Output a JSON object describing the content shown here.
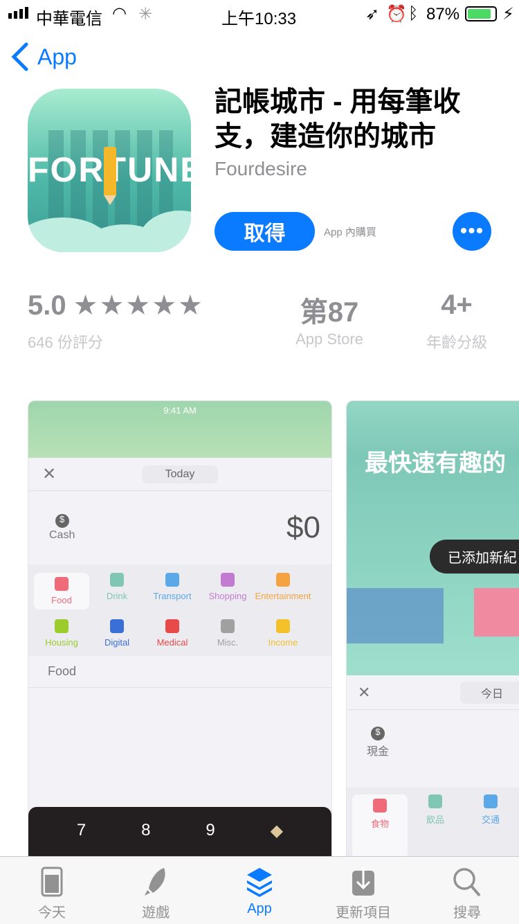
{
  "status_bar": {
    "carrier": "中華電信",
    "time": "上午10:33",
    "battery": "87%",
    "battery_level": 0.87
  },
  "nav": {
    "back_label": "App"
  },
  "app": {
    "icon_text": "FORTUNE",
    "title": "記帳城市 - 用每筆收支，建造你的城市",
    "developer": "Fourdesire",
    "get_label": "取得",
    "iap_label": "App 內購買",
    "more_label": "•••"
  },
  "ratings": {
    "score": "5.0",
    "stars": 5,
    "stars_text": "★★★★★",
    "count_label": "646 份評分",
    "rank": "第87",
    "rank_label": "App Store",
    "age": "4+",
    "age_label": "年齡分級"
  },
  "screenshot1": {
    "status_time": "9:41 AM",
    "date_label": "Today",
    "account": "Cash",
    "amount": "$0",
    "categories": [
      {
        "label": "Food",
        "color": "#f06a7a"
      },
      {
        "label": "Drink",
        "color": "#7fc6b4"
      },
      {
        "label": "Transport",
        "color": "#5aa8e8"
      },
      {
        "label": "Shopping",
        "color": "#c27bd0"
      },
      {
        "label": "Entertainment",
        "color": "#f5a340"
      },
      {
        "label": "Housing",
        "color": "#9bcc2b"
      },
      {
        "label": "Digital",
        "color": "#3a6fd8"
      },
      {
        "label": "Medical",
        "color": "#e84a4a"
      },
      {
        "label": "Misc.",
        "color": "#a0a0a0"
      },
      {
        "label": "Income",
        "color": "#f5c12a"
      }
    ],
    "selected_category": "Food",
    "keys": [
      "7",
      "8",
      "9"
    ]
  },
  "screenshot2": {
    "headline": "最快速有趣的",
    "toast": "已添加新紀",
    "date_label": "今日",
    "account": "現金",
    "categories": [
      {
        "label": "食物",
        "color": "#f06a7a"
      },
      {
        "label": "飲品",
        "color": "#7fc6b4"
      },
      {
        "label": "交通",
        "color": "#5aa8e8"
      }
    ]
  },
  "tabs": [
    {
      "label": "今天",
      "icon": "today-icon"
    },
    {
      "label": "遊戲",
      "icon": "rocket-icon"
    },
    {
      "label": "App",
      "icon": "layers-icon",
      "active": true
    },
    {
      "label": "更新項目",
      "icon": "download-icon"
    },
    {
      "label": "搜尋",
      "icon": "search-icon"
    }
  ],
  "colors": {
    "accent": "#0a7aff",
    "gray": "#8e8e93"
  }
}
